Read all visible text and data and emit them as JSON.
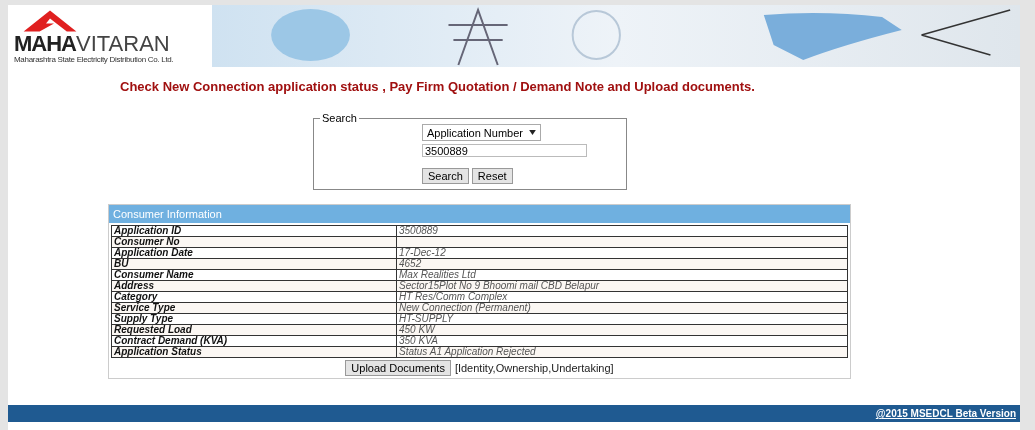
{
  "header": {
    "brand_strong": "MAHA",
    "brand_light": "VITARAN",
    "tagline": "Maharashtra State Electricity Distribution Co. Ltd."
  },
  "heading": "Check New Connection application status , Pay Firm Quotation / Demand Note and Upload documents.",
  "search": {
    "legend": "Search",
    "type_select": "Application Number",
    "value": "3500889",
    "buttons": [
      "Search",
      "Reset"
    ]
  },
  "consumer_info": {
    "title": "Consumer Information",
    "rows": [
      {
        "label": "Application ID",
        "value": "3500889"
      },
      {
        "label": "Consumer No",
        "value": ""
      },
      {
        "label": "Application Date",
        "value": "17-Dec-12"
      },
      {
        "label": "BU",
        "value": "4652"
      },
      {
        "label": "Consumer Name",
        "value": "Max Realities Ltd"
      },
      {
        "label": "Address",
        "value": "Sector15Plot No 9 Bhoomi mail CBD Belapur"
      },
      {
        "label": "Category",
        "value": "HT Res/Comm Complex"
      },
      {
        "label": "Service Type",
        "value": "New Connection (Permanent)"
      },
      {
        "label": "Supply Type",
        "value": "HT-SUPPLY"
      },
      {
        "label": "Requested Load",
        "value": "450 KW"
      },
      {
        "label": "Contract Demand (KVA)",
        "value": "350 KVA"
      },
      {
        "label": "Application Status",
        "value": "Status A1 Application Rejected"
      }
    ],
    "upload_button": "Upload Documents",
    "upload_note": "[Identity,Ownership,Undertaking]"
  },
  "footer": {
    "link": "@2015 MSEDCL Beta Version"
  }
}
